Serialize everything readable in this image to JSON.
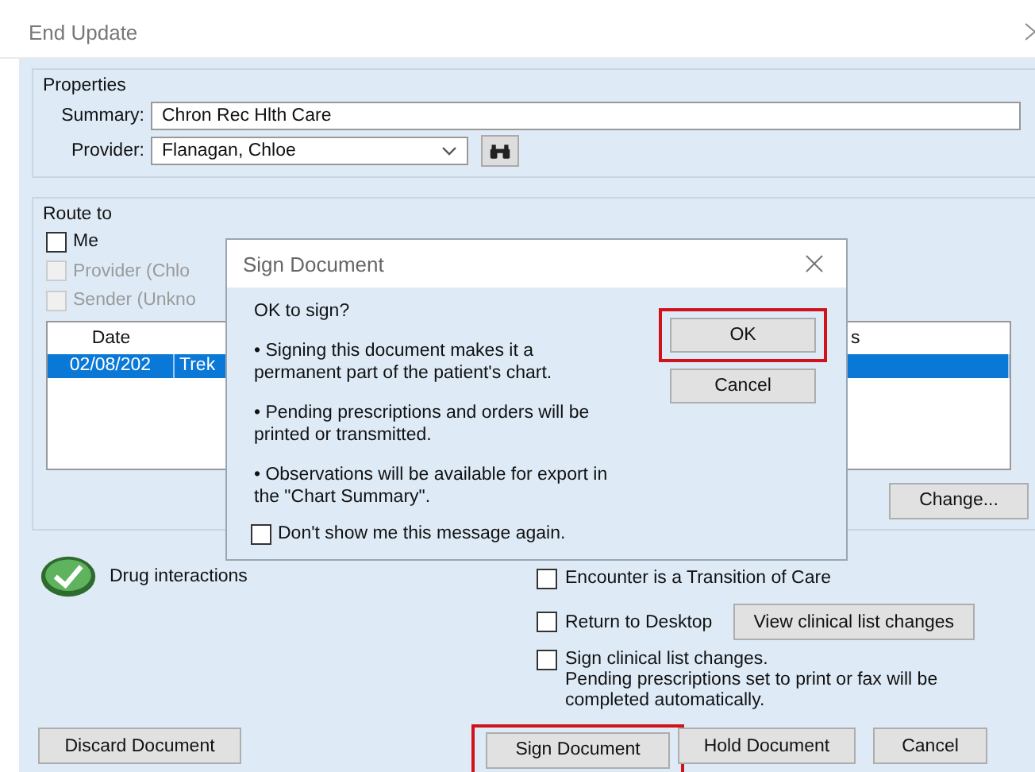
{
  "window": {
    "title": "End Update"
  },
  "properties": {
    "title": "Properties",
    "summary": {
      "label": "Summary:",
      "value": "Chron Rec Hlth Care"
    },
    "provider": {
      "label": "Provider:",
      "value": "Flanagan, Chloe"
    }
  },
  "route_to": {
    "title": "Route to",
    "options": [
      {
        "label": "Me",
        "checked": false,
        "disabled": false
      },
      {
        "label": "Provider (Chlo",
        "checked": false,
        "disabled": true
      },
      {
        "label": "Sender (Unkno",
        "checked": false,
        "disabled": true
      }
    ],
    "list": {
      "column_1": "Date",
      "column_3": "s",
      "rows": [
        {
          "date": "02/08/202",
          "column_2": "Trek",
          "selected": true
        }
      ]
    },
    "change_button": "Change..."
  },
  "drug_interactions": {
    "label": "Drug interactions"
  },
  "options": [
    {
      "label": "Encounter is a Transition of Care",
      "checked": false
    },
    {
      "label": "Return to Desktop",
      "checked": false
    },
    {
      "label": "Sign clinical list changes.",
      "note": "Pending prescriptions set to print or fax will be completed automatically.",
      "checked": false
    }
  ],
  "view_button": "View clinical list changes",
  "buttons": [
    {
      "label": "Discard Document",
      "highlighted": false
    },
    {
      "label": "Sign Document",
      "highlighted": true
    },
    {
      "label": "Hold Document",
      "highlighted": false
    },
    {
      "label": "Cancel",
      "highlighted": false
    }
  ],
  "dialog": {
    "title": "Sign Document",
    "question": "OK to sign?",
    "bullets": [
      "•  Signing this document makes it a permanent part of the patient's chart.",
      "•  Pending prescriptions and orders will be printed or transmitted.",
      "•  Observations will be available for export in the \"Chart Summary\"."
    ],
    "dont_show": {
      "label": "Don't show me this message again.",
      "checked": false
    },
    "buttons": [
      {
        "label": "OK",
        "highlighted": true
      },
      {
        "label": "Cancel",
        "highlighted": false
      }
    ]
  }
}
